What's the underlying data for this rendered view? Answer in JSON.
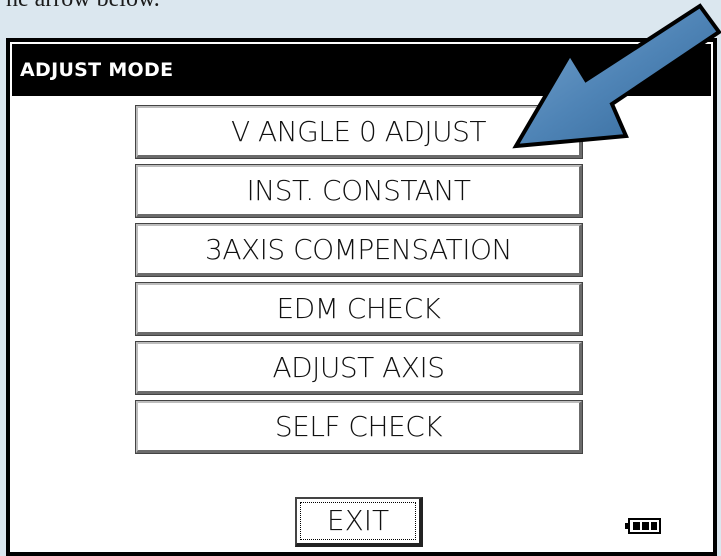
{
  "caption": {
    "text": "he arrow below."
  },
  "window": {
    "title": "ADJUST MODE"
  },
  "menu": {
    "items": [
      {
        "label": "V ANGLE 0 ADJUST"
      },
      {
        "label": "INST. CONSTANT"
      },
      {
        "label": "3AXIS COMPENSATION"
      },
      {
        "label": "EDM CHECK"
      },
      {
        "label": "ADJUST AXIS"
      },
      {
        "label": "SELF CHECK"
      }
    ]
  },
  "exit": {
    "label": "EXIT"
  },
  "battery": {
    "icon": "battery-icon",
    "level": "full"
  },
  "pointer": {
    "icon": "arrow-pointer-icon",
    "target": "V ANGLE 0 ADJUST",
    "color": "#3e74a8"
  },
  "colors": {
    "background": "#dbe7ef",
    "titlebar": "#000000",
    "button_face": "#ffffff"
  }
}
